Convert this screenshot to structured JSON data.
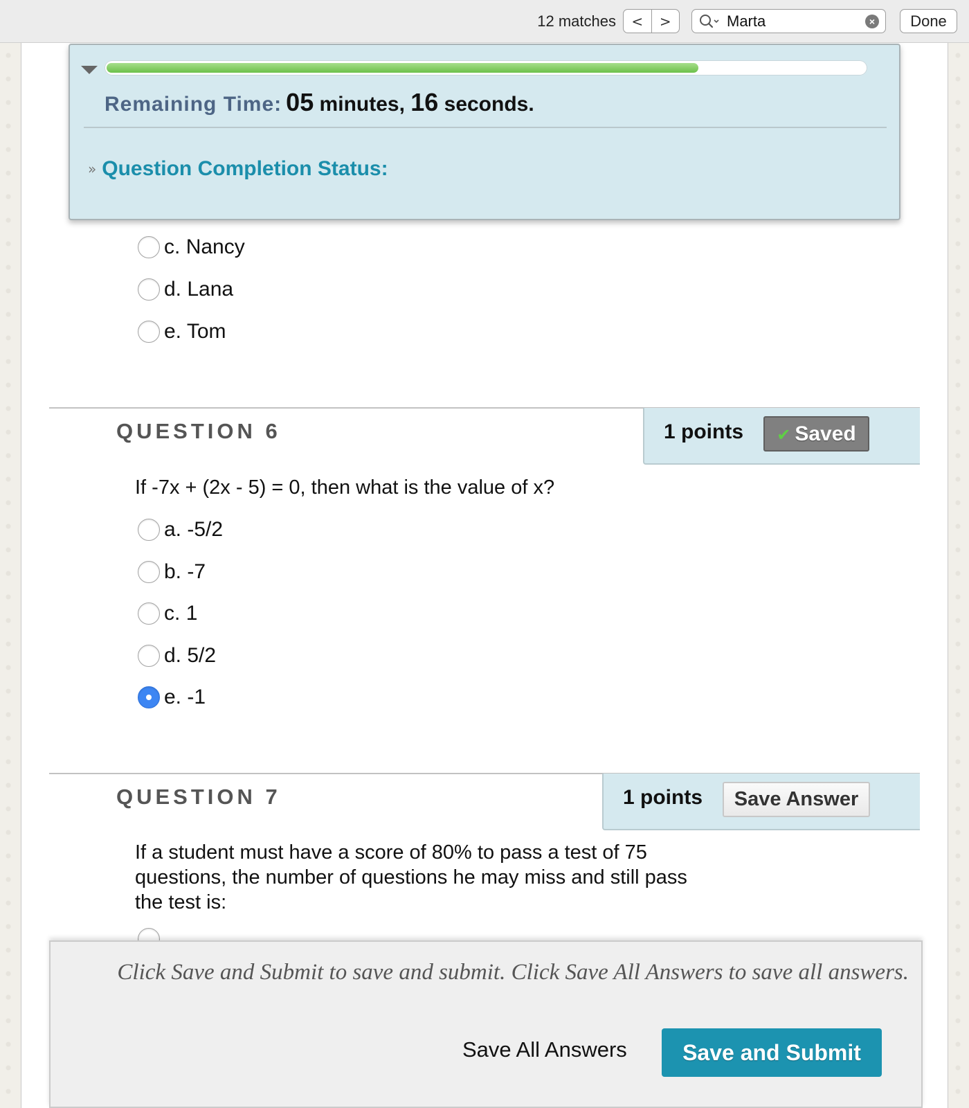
{
  "find_bar": {
    "matches_text": "12 matches",
    "prev_label": "<",
    "next_label": ">",
    "search_value": "Marta",
    "clear_glyph": "×",
    "done_label": "Done"
  },
  "timer_panel": {
    "progress_fraction": 0.78,
    "remaining_label": "Remaining Time:",
    "minutes": "05",
    "minutes_unit": " minutes, ",
    "seconds": "16",
    "seconds_unit": " seconds.",
    "completion_status_label": "Question Completion Status:",
    "colors": {
      "progress": "#6cc14a",
      "panel": "#d5e9ef",
      "heading": "#1b8eab"
    }
  },
  "previous_question_options": [
    {
      "letter": "c.",
      "text": "Nancy",
      "selected": false
    },
    {
      "letter": "d.",
      "text": "Lana",
      "selected": false
    },
    {
      "letter": "e.",
      "text": "Tom",
      "selected": false
    }
  ],
  "question6": {
    "title": "QUESTION 6",
    "points": "1 points",
    "status_button": "Saved",
    "status_icon": "check-icon",
    "prompt": "If -7x + (2x - 5) = 0, then what is the value of x?",
    "options": [
      {
        "letter": "a.",
        "text": "-5/2",
        "selected": false
      },
      {
        "letter": "b.",
        "text": "-7",
        "selected": false
      },
      {
        "letter": "c.",
        "text": "1",
        "selected": false
      },
      {
        "letter": "d.",
        "text": "5/2",
        "selected": false
      },
      {
        "letter": "e.",
        "text": "-1",
        "selected": true
      }
    ]
  },
  "question7": {
    "title": "QUESTION 7",
    "points": "1 points",
    "save_button": "Save Answer",
    "prompt_line1": "If a student must have a score of 80% to pass a test of 75",
    "prompt_line2": "questions, the number of questions he may miss and still pass",
    "prompt_line3": "the test is:"
  },
  "submit_bar": {
    "instructions": "Click Save and Submit to save and submit. Click Save All Answers to save all answers.",
    "save_all_label": "Save All Answers",
    "submit_label": "Save and Submit",
    "submit_color": "#1c93b0"
  }
}
